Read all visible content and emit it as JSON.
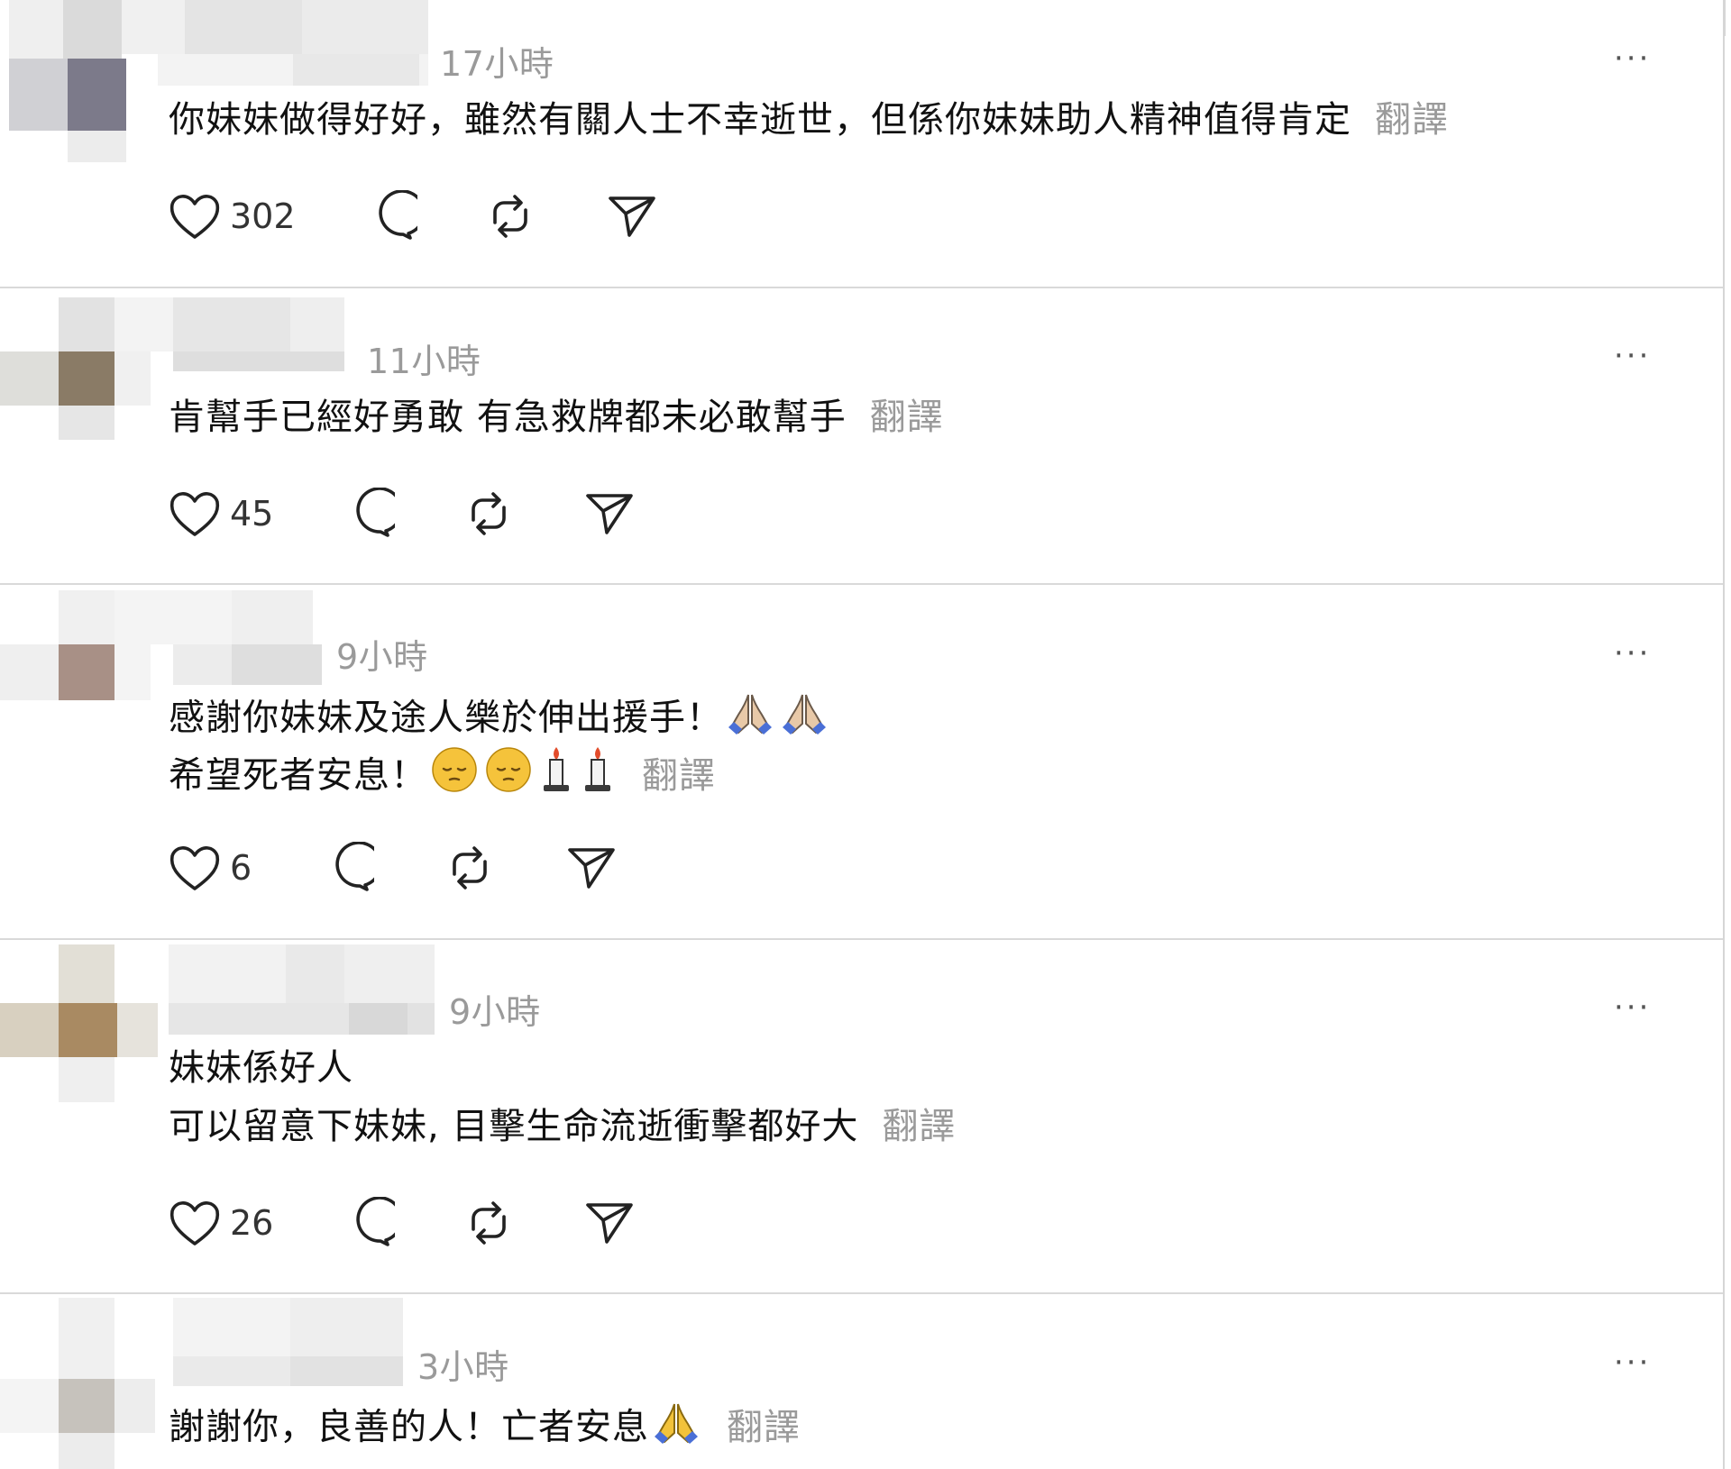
{
  "colors": {
    "text": "#111111",
    "muted": "#9a9a9a",
    "divider": "#d9d9d9",
    "icon": "#222222",
    "emoji_yellow": "#f5c33b",
    "emoji_hands": "#e8c9a8"
  },
  "comments": [
    {
      "time": "17小時",
      "lines": [
        "你妹妹做得好好，雖然有關人士不幸逝世，但係你妹妹助人精神值得肯定"
      ],
      "translate": "翻譯",
      "likes": "302",
      "more": "···",
      "icons": [
        "heart-icon",
        "comment-icon",
        "repost-icon",
        "share-icon"
      ]
    },
    {
      "time": "11小時",
      "lines": [
        "肯幫手已經好勇敢 有急救牌都未必敢幫手"
      ],
      "translate": "翻譯",
      "likes": "45",
      "more": "···"
    },
    {
      "time": "9小時",
      "lines": [
        "感謝你妹妹及途人樂於伸出援手！",
        "希望死者安息！"
      ],
      "line_emojis": [
        [
          "folded-hands",
          "folded-hands"
        ],
        [
          "pensive-face",
          "pensive-face",
          "candle",
          "candle"
        ]
      ],
      "translate": "翻譯",
      "likes": "6",
      "more": "···"
    },
    {
      "time": "9小時",
      "lines": [
        "妹妹係好人",
        "可以留意下妹妹, 目擊生命流逝衝擊都好大"
      ],
      "translate": "翻譯",
      "likes": "26",
      "more": "···"
    },
    {
      "time": "3小時",
      "lines": [
        "謝謝你，良善的人！亡者安息"
      ],
      "line_emojis": [
        [
          "folded-hands"
        ]
      ],
      "translate": "翻譯",
      "more": "···"
    }
  ]
}
